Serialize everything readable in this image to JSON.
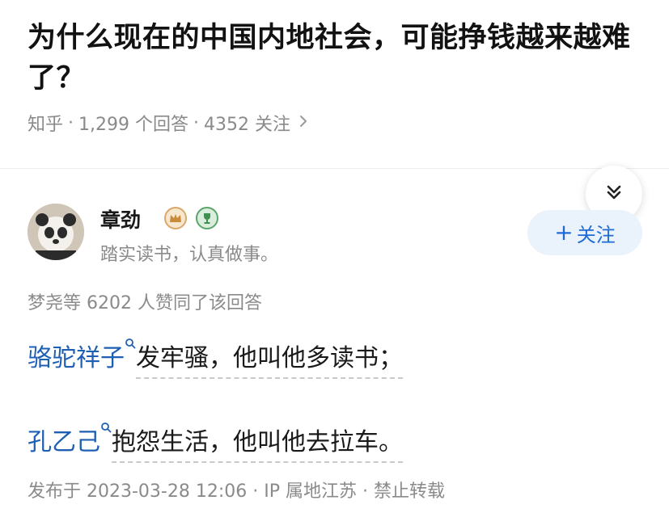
{
  "question": {
    "title": "为什么现在的中国内地社会，可能挣钱越来越难了？",
    "source": "知乎",
    "answer_count": "1,299 个回答",
    "follow_count": "4352 关注",
    "separator": "·"
  },
  "author": {
    "name": "章劲",
    "bio": "踏实读书，认真做事。",
    "follow_label": "关注",
    "follow_plus": "+"
  },
  "answer": {
    "likes": "梦尧等 6202 人赞同了该回答",
    "p1_link": "骆驼祥子",
    "p1_text": "发牢骚，他叫他多读书；",
    "p2_link": "孔乙己",
    "p2_text": "抱怨生活，他叫他去拉车。",
    "footer": "发布于 2023-03-28 12:06 · IP 属地江苏 · 禁止转载"
  },
  "icons": {
    "collapse": "double-chevron-down-icon",
    "search_sup": "search-icon",
    "meta_chevron": "chevron-right-icon"
  },
  "colors": {
    "link": "#1e5fb4",
    "follow_text": "#1e6bd6",
    "follow_bg": "#eaf2fc",
    "meta_gray": "#8a8a8a"
  }
}
